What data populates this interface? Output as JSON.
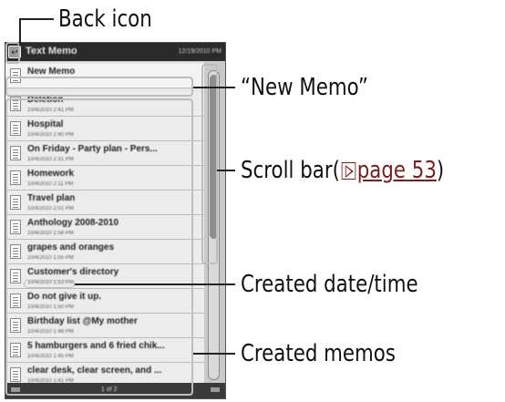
{
  "screen": {
    "title": "Text Memo",
    "clock": "12/19/2010 PM",
    "new_memo": "New Memo",
    "pager": "1 of 2",
    "memos": [
      {
        "title": "Deletion",
        "date": "10/4/2010 2:41 PM"
      },
      {
        "title": "Hospital",
        "date": "10/4/2010 2:40 PM"
      },
      {
        "title": "On Friday  - Party plan  - Pers...",
        "date": "10/4/2010 2:31 PM"
      },
      {
        "title": "Homework",
        "date": "10/4/2010 2:11 PM"
      },
      {
        "title": "Travel plan",
        "date": "10/4/2010 2:01 PM"
      },
      {
        "title": "Anthology 2008-2010",
        "date": "10/4/2010 1:58 PM"
      },
      {
        "title": "grapes and oranges",
        "date": "10/4/2010 1:55 PM"
      },
      {
        "title": "Customer's directory",
        "date": "10/4/2010 1:53 PM"
      },
      {
        "title": "Do not give it up.",
        "date": "10/4/2010 1:50 PM"
      },
      {
        "title": "Birthday list  @My mother",
        "date": "10/4/2010 1:48 PM"
      },
      {
        "title": "5 hamburgers and 6 fried chik...",
        "date": "10/4/2010 1:45 PM"
      },
      {
        "title": "clear desk, clear screen, and ...",
        "date": "10/4/2010 1:41 PM"
      }
    ]
  },
  "callouts": {
    "back_icon": "Back icon",
    "new_memo": "“New Memo”",
    "scroll_bar_prefix": "Scroll bar(",
    "scroll_bar_page": "page 53",
    "scroll_bar_suffix": ")",
    "created_datetime": "Created date/time",
    "created_memos": "Created memos"
  }
}
